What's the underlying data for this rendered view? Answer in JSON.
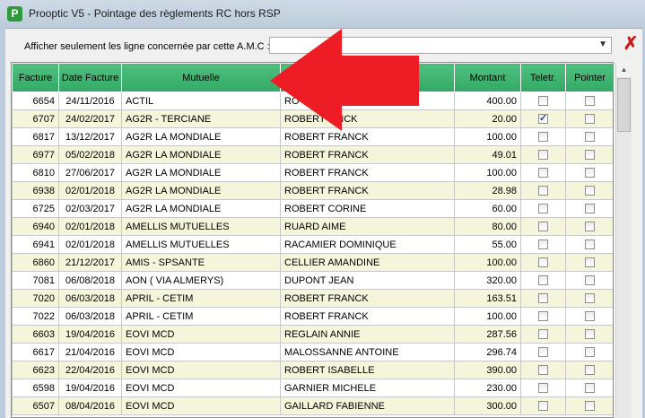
{
  "window": {
    "title": "Prooptic V5 - Pointage des règlements RC hors RSP",
    "icon_letter": "P"
  },
  "filter": {
    "label": "Afficher seulement les ligne concernée par cette A.M.C :",
    "value": ""
  },
  "columns": {
    "facture": "Facture",
    "date": "Date Facture",
    "mutuelle": "Mutuelle",
    "patient": "",
    "montant": "Montant",
    "teletr": "Teletr.",
    "pointer": "Pointer"
  },
  "rows": [
    {
      "facture": "6654",
      "date": "24/11/2016",
      "mutuelle": "ACTIL",
      "patient": "RO",
      "montant": "400.00",
      "teletr": false,
      "pointer": false
    },
    {
      "facture": "6707",
      "date": "24/02/2017",
      "mutuelle": "AG2R - TERCIANE",
      "patient": "ROBERT F    NCK",
      "montant": "20.00",
      "teletr": true,
      "pointer": false
    },
    {
      "facture": "6817",
      "date": "13/12/2017",
      "mutuelle": "AG2R LA MONDIALE",
      "patient": "ROBERT FRANCK",
      "montant": "100.00",
      "teletr": false,
      "pointer": false
    },
    {
      "facture": "6977",
      "date": "05/02/2018",
      "mutuelle": "AG2R LA MONDIALE",
      "patient": "ROBERT FRANCK",
      "montant": "49.01",
      "teletr": false,
      "pointer": false
    },
    {
      "facture": "6810",
      "date": "27/06/2017",
      "mutuelle": "AG2R LA MONDIALE",
      "patient": "ROBERT FRANCK",
      "montant": "100.00",
      "teletr": false,
      "pointer": false
    },
    {
      "facture": "6938",
      "date": "02/01/2018",
      "mutuelle": "AG2R LA MONDIALE",
      "patient": "ROBERT FRANCK",
      "montant": "28.98",
      "teletr": false,
      "pointer": false
    },
    {
      "facture": "6725",
      "date": "02/03/2017",
      "mutuelle": "AG2R LA MONDIALE",
      "patient": "ROBERT CORINE",
      "montant": "60.00",
      "teletr": false,
      "pointer": false
    },
    {
      "facture": "6940",
      "date": "02/01/2018",
      "mutuelle": "AMELLIS MUTUELLES",
      "patient": "RUARD AIME",
      "montant": "80.00",
      "teletr": false,
      "pointer": false
    },
    {
      "facture": "6941",
      "date": "02/01/2018",
      "mutuelle": "AMELLIS MUTUELLES",
      "patient": "RACAMIER DOMINIQUE",
      "montant": "55.00",
      "teletr": false,
      "pointer": false
    },
    {
      "facture": "6860",
      "date": "21/12/2017",
      "mutuelle": "AMIS - SPSANTE",
      "patient": "CELLIER AMANDINE",
      "montant": "100.00",
      "teletr": false,
      "pointer": false
    },
    {
      "facture": "7081",
      "date": "06/08/2018",
      "mutuelle": "AON ( VIA ALMERYS)",
      "patient": "DUPONT JEAN",
      "montant": "320.00",
      "teletr": false,
      "pointer": false
    },
    {
      "facture": "7020",
      "date": "06/03/2018",
      "mutuelle": "APRIL - CETIM",
      "patient": "ROBERT FRANCK",
      "montant": "163.51",
      "teletr": false,
      "pointer": false
    },
    {
      "facture": "7022",
      "date": "06/03/2018",
      "mutuelle": "APRIL - CETIM",
      "patient": "ROBERT FRANCK",
      "montant": "100.00",
      "teletr": false,
      "pointer": false
    },
    {
      "facture": "6603",
      "date": "19/04/2016",
      "mutuelle": "EOVI MCD",
      "patient": "REGLAIN ANNIE",
      "montant": "287.56",
      "teletr": false,
      "pointer": false
    },
    {
      "facture": "6617",
      "date": "21/04/2016",
      "mutuelle": "EOVI MCD",
      "patient": "MALOSSANNE ANTOINE",
      "montant": "296.74",
      "teletr": false,
      "pointer": false
    },
    {
      "facture": "6623",
      "date": "22/04/2016",
      "mutuelle": "EOVI MCD",
      "patient": "ROBERT ISABELLE",
      "montant": "390.00",
      "teletr": false,
      "pointer": false
    },
    {
      "facture": "6598",
      "date": "19/04/2016",
      "mutuelle": "EOVI MCD",
      "patient": "GARNIER MICHELE",
      "montant": "230.00",
      "teletr": false,
      "pointer": false
    },
    {
      "facture": "6507",
      "date": "08/04/2016",
      "mutuelle": "EOVI MCD",
      "patient": "GAILLARD FABIENNE",
      "montant": "300.00",
      "teletr": false,
      "pointer": false
    }
  ],
  "colors": {
    "header_green": "#3cb371",
    "row_alt": "#f5f5dc",
    "annotation_arrow": "#ee1c25"
  }
}
